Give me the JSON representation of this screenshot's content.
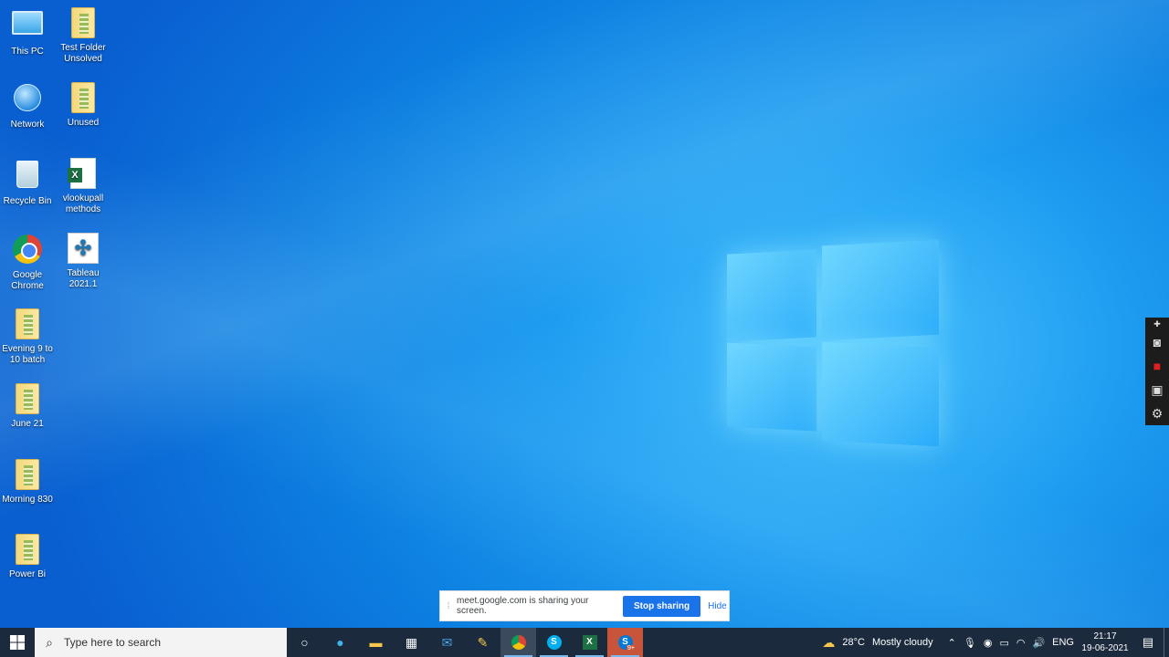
{
  "desktop": {
    "icons": [
      {
        "label": "This PC"
      },
      {
        "label": "Test Folder Unsolved"
      },
      {
        "label": "Network"
      },
      {
        "label": "Unused"
      },
      {
        "label": "Recycle Bin"
      },
      {
        "label": "vlookupall methods"
      },
      {
        "label": "Google Chrome"
      },
      {
        "label": "Tableau 2021.1"
      },
      {
        "label": "Evening 9 to 10 batch"
      },
      {
        "label": "June 21"
      },
      {
        "label": "Morning 830"
      },
      {
        "label": "Power Bi"
      }
    ]
  },
  "share_bar": {
    "message": "meet.google.com is sharing your screen.",
    "stop_label": "Stop sharing",
    "hide_label": "Hide"
  },
  "taskbar": {
    "search_placeholder": "Type here to search",
    "weather_temp": "28°C",
    "weather_desc": "Mostly cloudy",
    "language": "ENG",
    "time": "21:17",
    "date": "19-06-2021",
    "skype_badge": "9+"
  },
  "colors": {
    "taskbar_bg": "#1b2a3d",
    "accent": "#1a73e8"
  }
}
